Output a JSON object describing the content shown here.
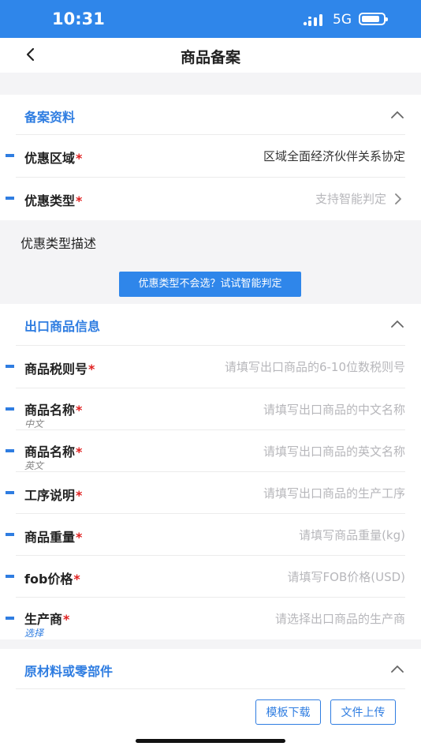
{
  "status": {
    "time": "10:31",
    "network": "5G"
  },
  "nav": {
    "title": "商品备案"
  },
  "sections": {
    "filing": {
      "title": "备案资料"
    },
    "export": {
      "title": "出口商品信息"
    },
    "materials": {
      "title": "原材料或零部件"
    }
  },
  "filing_rows": [
    {
      "label": "优惠区域",
      "value": "区域全面经济伙伴关系协定"
    },
    {
      "label": "优惠类型",
      "value": "支持智能判定"
    }
  ],
  "description": {
    "label": "优惠类型描述",
    "button": "优惠类型不会选？试试智能判定"
  },
  "export_rows": [
    {
      "label": "商品税则号",
      "placeholder": "请填写出口商品的6-10位数税则号",
      "sub": ""
    },
    {
      "label": "商品名称",
      "placeholder": "请填写出口商品的中文名称",
      "sub": "中文"
    },
    {
      "label": "商品名称",
      "placeholder": "请填写出口商品的英文名称",
      "sub": "英文"
    },
    {
      "label": "工序说明",
      "placeholder": "请填写出口商品的生产工序",
      "sub": ""
    },
    {
      "label": "商品重量",
      "placeholder": "请填写商品重量(kg)",
      "sub": ""
    },
    {
      "label": "fob价格",
      "placeholder": "请填写FOB价格(USD)",
      "sub": ""
    },
    {
      "label": "生产商",
      "placeholder": "请选择出口商品的生产商",
      "sub": "选择"
    }
  ],
  "required_mark": "*",
  "material_buttons": {
    "template_download": "模板下载",
    "file_upload": "文件上传"
  },
  "colors": {
    "primary": "#2f86ea",
    "accent_text": "#2f7de1",
    "required": "#e02020"
  }
}
